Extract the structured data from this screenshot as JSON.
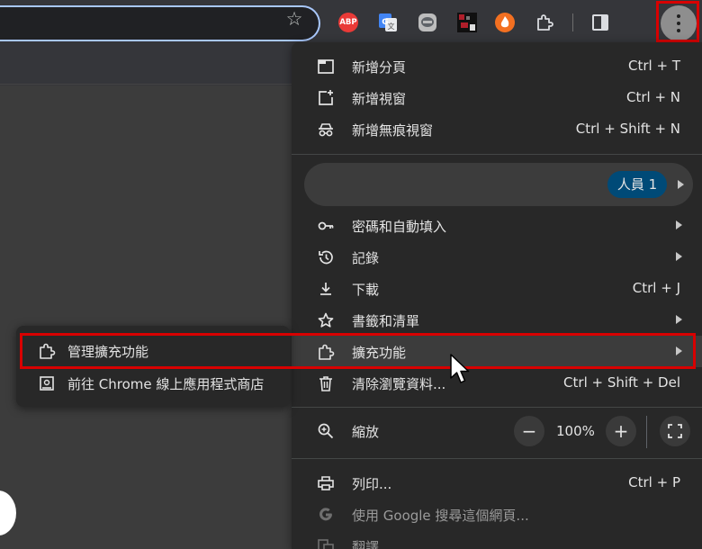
{
  "toolbar": {
    "extensions": [
      {
        "name": "adblock-plus-icon",
        "label": "ABP"
      },
      {
        "name": "google-translate-icon"
      },
      {
        "name": "line-icon"
      },
      {
        "name": "dark-extension-icon"
      },
      {
        "name": "flame-extension-icon"
      },
      {
        "name": "extensions-puzzle-icon"
      }
    ],
    "highlight_color": "#d80000"
  },
  "menu": {
    "new_tab": {
      "label": "新增分頁",
      "shortcut": "Ctrl + T"
    },
    "new_window": {
      "label": "新增視窗",
      "shortcut": "Ctrl + N"
    },
    "new_incognito": {
      "label": "新增無痕視窗",
      "shortcut": "Ctrl + Shift + N"
    },
    "profile": {
      "label": "人員 1"
    },
    "passwords": {
      "label": "密碼和自動填入"
    },
    "history": {
      "label": "記錄"
    },
    "downloads": {
      "label": "下載",
      "shortcut": "Ctrl + J"
    },
    "bookmarks": {
      "label": "書籤和清單"
    },
    "extensions": {
      "label": "擴充功能"
    },
    "clear_data": {
      "label": "清除瀏覽資料...",
      "shortcut": "Ctrl + Shift + Del"
    },
    "zoom": {
      "label": "縮放",
      "minus": "−",
      "value": "100%",
      "plus": "+"
    },
    "print": {
      "label": "列印...",
      "shortcut": "Ctrl + P"
    },
    "search_google": {
      "label": "使用 Google 搜尋這個網頁..."
    },
    "translate": {
      "label": "翻譯"
    }
  },
  "submenu": {
    "manage": {
      "label": "管理擴充功能"
    },
    "store": {
      "label": "前往 Chrome 線上應用程式商店"
    }
  },
  "colors": {
    "menu_bg": "#282828",
    "hover_bg": "#3c3c3c",
    "profile_chip": "#004a77",
    "focus_ring": "#a8c7fa"
  }
}
